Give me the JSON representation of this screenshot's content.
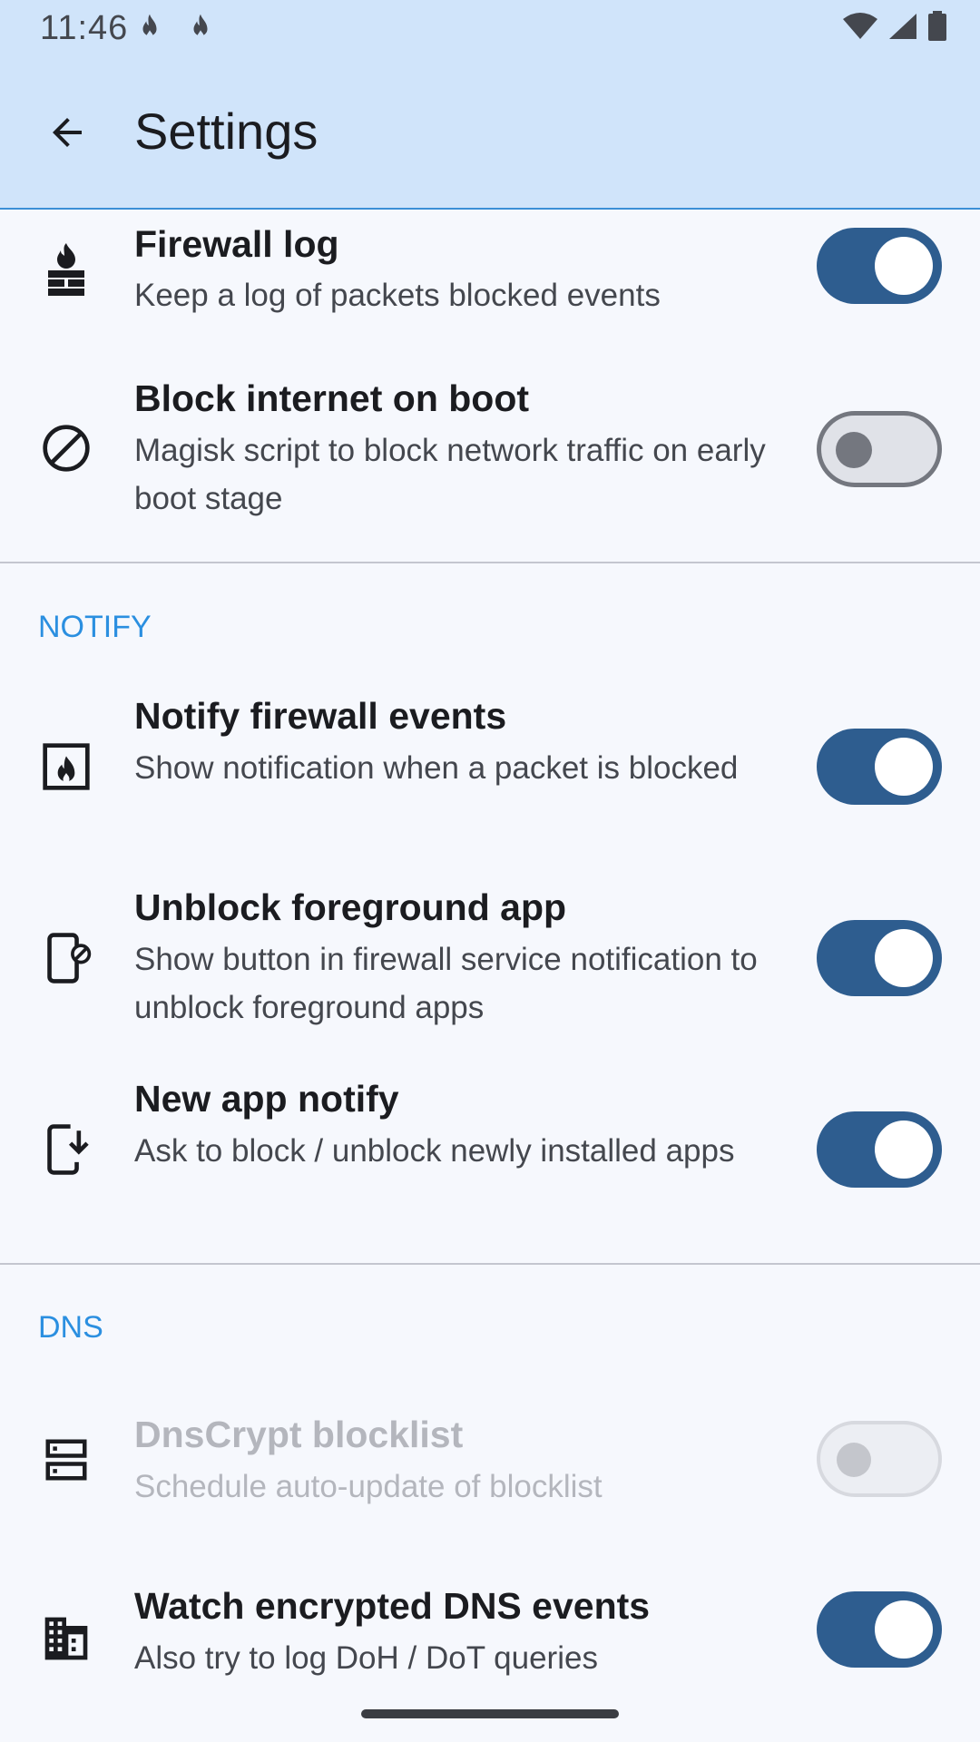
{
  "status_bar": {
    "time": "11:46",
    "icons": [
      "flame-icon",
      "flame-icon",
      "wifi-icon",
      "cellular-signal-icon",
      "battery-icon"
    ]
  },
  "app_bar": {
    "back_icon": "arrow-back-icon",
    "title": "Settings"
  },
  "rows": [
    {
      "title": "Firewall log",
      "summary": "Keep a log of packets blocked events",
      "icon": "firewall-icon",
      "state": "on",
      "enabled": true
    },
    {
      "title": "Block internet on boot",
      "summary": "Magisk script to block network traffic on early boot stage",
      "icon": "block-icon",
      "state": "off",
      "enabled": true
    }
  ],
  "sections": {
    "notify": {
      "header": "NOTIFY",
      "rows": [
        {
          "title": "Notify firewall events",
          "summary": "Show notification when a packet is blocked",
          "icon": "fire-notification-icon",
          "state": "on",
          "enabled": true
        },
        {
          "title": "Unblock foreground app",
          "summary": "Show button in firewall service notification to unblock foreground apps",
          "icon": "phone-unblock-icon",
          "state": "on",
          "enabled": true
        },
        {
          "title": "New app notify",
          "summary": "Ask to block / unblock newly installed apps",
          "icon": "install-mobile-icon",
          "state": "on",
          "enabled": true
        }
      ]
    },
    "dns": {
      "header": "DNS",
      "rows": [
        {
          "title": "DnsCrypt blocklist",
          "summary": "Schedule auto-update of blocklist",
          "icon": "dns-server-icon",
          "state": "off",
          "enabled": false
        },
        {
          "title": "Watch encrypted DNS events",
          "summary": "Also try to log DoH / DoT queries",
          "icon": "domain-icon",
          "state": "on",
          "enabled": true
        }
      ]
    }
  },
  "colors": {
    "app_bar": "#d0e4fa",
    "background": "#f6f8fd",
    "switch_on": "#2e5d8f",
    "section_header": "#2b8fe0"
  }
}
